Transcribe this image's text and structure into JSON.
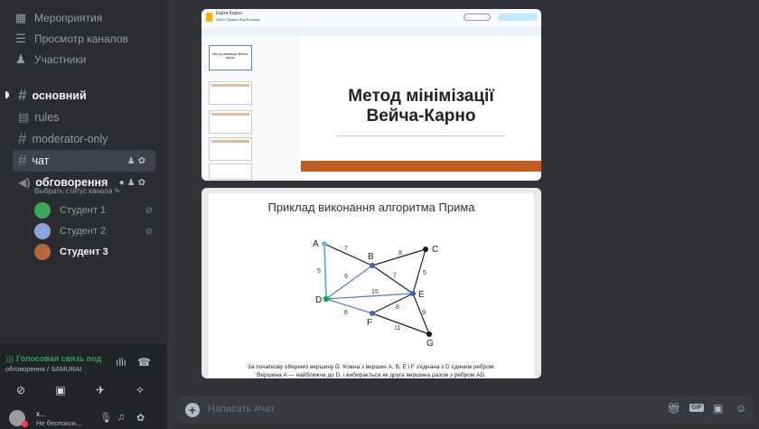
{
  "sidebar": {
    "top_items": [
      {
        "icon": "calendar-icon",
        "label": "Мероприятия"
      },
      {
        "icon": "channels-browse-icon",
        "label": "Просмотр каналов"
      },
      {
        "icon": "members-icon",
        "label": "Участники"
      }
    ],
    "channels": [
      {
        "name": "основний",
        "type": "text"
      },
      {
        "name": "rules",
        "type": "rules"
      },
      {
        "name": "moderator-only",
        "type": "text-locked"
      },
      {
        "name": "чат",
        "type": "text"
      },
      {
        "name": "обговорення",
        "type": "voice",
        "status_hint": "Выбрать статус канала"
      }
    ],
    "voice_members": [
      {
        "name": "Студент 1",
        "color": "#3ba55c"
      },
      {
        "name": "Студент 2",
        "color": "#5865f2"
      },
      {
        "name": "Студент 3",
        "color": "#b4693d"
      }
    ]
  },
  "voice_panel": {
    "title": "Голосовая связь под",
    "subtitle": "обговорення / SAMURAI"
  },
  "user_panel": {
    "name": "x...",
    "status": "Не беспокои..."
  },
  "slides_app": {
    "title": "Карти Карно",
    "menu": "Файл  Правка  Вид  Вставка",
    "thumb_title": "Метод мінімізації Вейча-Карно"
  },
  "slide1": {
    "line1": "Метод мінімізації",
    "line2": "Вейча-Карно"
  },
  "slide2": {
    "title": "Приклад виконання алгоритма Прима",
    "caption_line1": "За початкову оберемо вершину D. Кожна з вершин A, B, E і F з'єднана з D єдиним ребром.",
    "caption_line2": "Вершина A — найближча до D, і вибирається як друга вершина разом з ребром AD.",
    "vertices": [
      "A",
      "B",
      "C",
      "D",
      "E",
      "F",
      "G"
    ],
    "weights": [
      "7",
      "8",
      "5",
      "9",
      "7",
      "5",
      "15",
      "8",
      "9",
      "6",
      "11"
    ]
  },
  "composer": {
    "placeholder": "Написать #чат"
  },
  "colors": {
    "accent_green": "#23a559",
    "sidebar_bg": "#2b2d31",
    "chat_bg": "#313338"
  }
}
